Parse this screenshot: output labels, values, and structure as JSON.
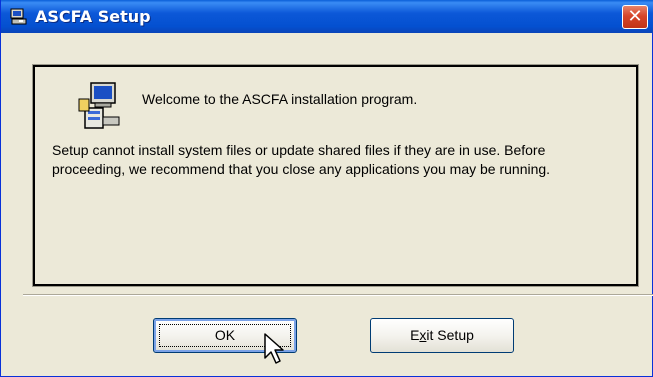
{
  "window": {
    "title": "ASCFA Setup",
    "close_glyph": "✕"
  },
  "content": {
    "welcome": "Welcome to the ASCFA installation program.",
    "body": "Setup cannot install system files or update shared files if they are in use. Before proceeding, we recommend that you close any applications you may be running."
  },
  "buttons": {
    "ok_label": "OK",
    "exit_prefix": "E",
    "exit_mnemonic": "x",
    "exit_suffix": "it Setup"
  },
  "icons": {
    "title": "setup-computer-icon",
    "app": "setup-computer-icon",
    "close": "close-icon",
    "cursor": "mouse-pointer-icon"
  },
  "colors": {
    "titlebar": "#0c58d8",
    "close": "#d6452a",
    "dialog_bg": "#ece9d8"
  }
}
